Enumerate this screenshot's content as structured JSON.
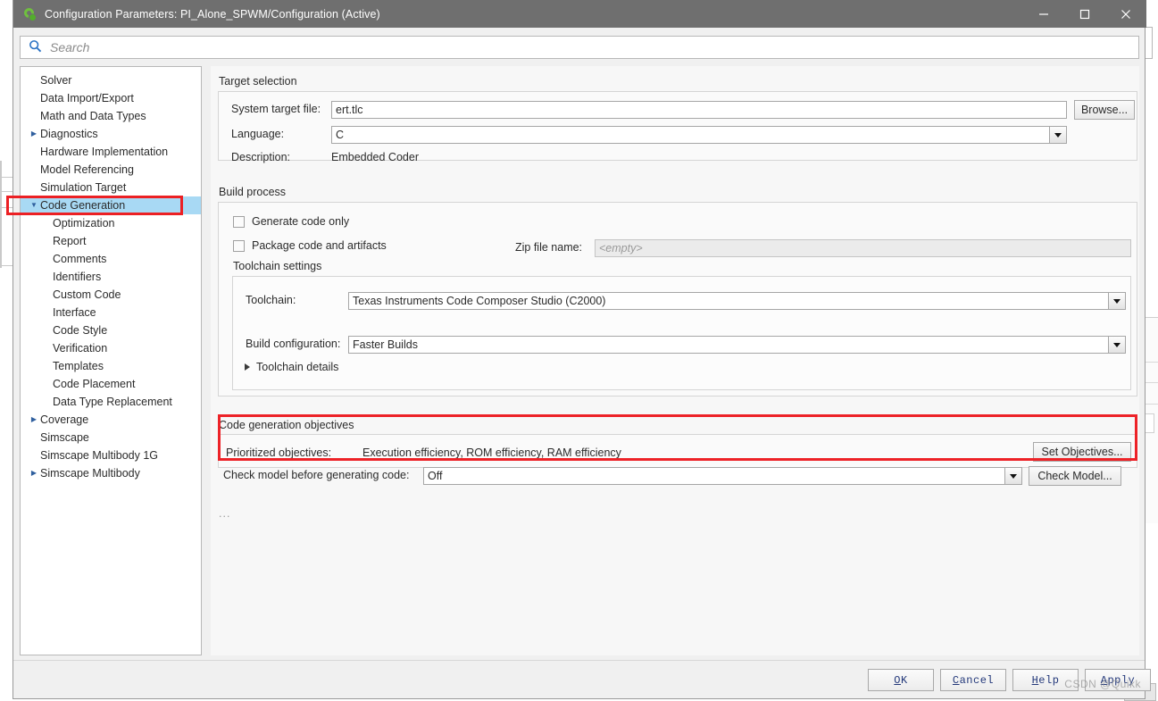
{
  "window": {
    "title": "Configuration Parameters: PI_Alone_SPWM/Configuration (Active)",
    "icon": "simulink-icon",
    "minimize_label": "—",
    "maximize_label": "□",
    "close_label": "✕"
  },
  "search": {
    "placeholder": "Search",
    "value": "",
    "icon": "search-icon"
  },
  "sidebar": {
    "items": [
      {
        "label": "Solver",
        "level": 0,
        "twisty": "",
        "selected": false
      },
      {
        "label": "Data Import/Export",
        "level": 0,
        "twisty": "",
        "selected": false
      },
      {
        "label": "Math and Data Types",
        "level": 0,
        "twisty": "",
        "selected": false
      },
      {
        "label": "Diagnostics",
        "level": 0,
        "twisty": "▶",
        "selected": false
      },
      {
        "label": "Hardware Implementation",
        "level": 0,
        "twisty": "",
        "selected": false
      },
      {
        "label": "Model Referencing",
        "level": 0,
        "twisty": "",
        "selected": false
      },
      {
        "label": "Simulation Target",
        "level": 0,
        "twisty": "",
        "selected": false
      },
      {
        "label": "Code Generation",
        "level": 0,
        "twisty": "▼",
        "selected": true
      },
      {
        "label": "Optimization",
        "level": 1,
        "twisty": "",
        "selected": false
      },
      {
        "label": "Report",
        "level": 1,
        "twisty": "",
        "selected": false
      },
      {
        "label": "Comments",
        "level": 1,
        "twisty": "",
        "selected": false
      },
      {
        "label": "Identifiers",
        "level": 1,
        "twisty": "",
        "selected": false
      },
      {
        "label": "Custom Code",
        "level": 1,
        "twisty": "",
        "selected": false
      },
      {
        "label": "Interface",
        "level": 1,
        "twisty": "",
        "selected": false
      },
      {
        "label": "Code Style",
        "level": 1,
        "twisty": "",
        "selected": false
      },
      {
        "label": "Verification",
        "level": 1,
        "twisty": "",
        "selected": false
      },
      {
        "label": "Templates",
        "level": 1,
        "twisty": "",
        "selected": false
      },
      {
        "label": "Code Placement",
        "level": 1,
        "twisty": "",
        "selected": false
      },
      {
        "label": "Data Type Replacement",
        "level": 1,
        "twisty": "",
        "selected": false
      },
      {
        "label": "Coverage",
        "level": 0,
        "twisty": "▶",
        "selected": false
      },
      {
        "label": "Simscape",
        "level": 0,
        "twisty": "",
        "selected": false
      },
      {
        "label": "Simscape Multibody 1G",
        "level": 0,
        "twisty": "",
        "selected": false
      },
      {
        "label": "Simscape Multibody",
        "level": 0,
        "twisty": "▶",
        "selected": false
      }
    ]
  },
  "main": {
    "target_selection": {
      "title": "Target selection",
      "system_target_file_label": "System target file:",
      "system_target_file_value": "ert.tlc",
      "browse_button": "Browse...",
      "language_label": "Language:",
      "language_value": "C",
      "description_label": "Description:",
      "description_value": "Embedded Coder"
    },
    "build_process": {
      "title": "Build process",
      "generate_code_only_label": "Generate code only",
      "generate_code_only_checked": false,
      "package_code_label": "Package code and artifacts",
      "package_code_checked": false,
      "zip_file_name_label": "Zip file name:",
      "zip_file_name_value": "<empty>",
      "toolchain_settings_title": "Toolchain settings",
      "toolchain_label": "Toolchain:",
      "toolchain_value": "Texas Instruments Code Composer Studio (C2000)",
      "build_configuration_label": "Build configuration:",
      "build_configuration_value": "Faster Builds",
      "toolchain_details_label": "Toolchain details"
    },
    "code_generation_objectives": {
      "title": "Code generation objectives",
      "prioritized_objectives_label": "Prioritized objectives:",
      "prioritized_objectives_value": "Execution efficiency, ROM efficiency, RAM efficiency",
      "set_objectives_button": "Set Objectives...",
      "check_model_label": "Check model before generating code:",
      "check_model_value": "Off",
      "check_model_button": "Check Model..."
    },
    "trailing_ellipsis": "..."
  },
  "footer": {
    "ok_pre": "",
    "ok_mnemonic": "O",
    "ok_post": "K",
    "cancel_pre": "",
    "cancel_mnemonic": "C",
    "cancel_post": "ancel",
    "help_pre": "",
    "help_mnemonic": "H",
    "help_post": "elp",
    "apply_pre": "",
    "apply_mnemonic": "A",
    "apply_post": "pply",
    "ok_label": "OK",
    "cancel_label": "Cancel",
    "help_label": "Help",
    "apply_label": "Apply"
  },
  "watermark": {
    "text": "CSDN @Quikk"
  },
  "colors": {
    "titlebar": "#6f6f6f",
    "selection": "#a8d9f4",
    "highlight_red": "#ec2024",
    "panel": "#f7f7f7",
    "accent_blue": "#23387a"
  }
}
